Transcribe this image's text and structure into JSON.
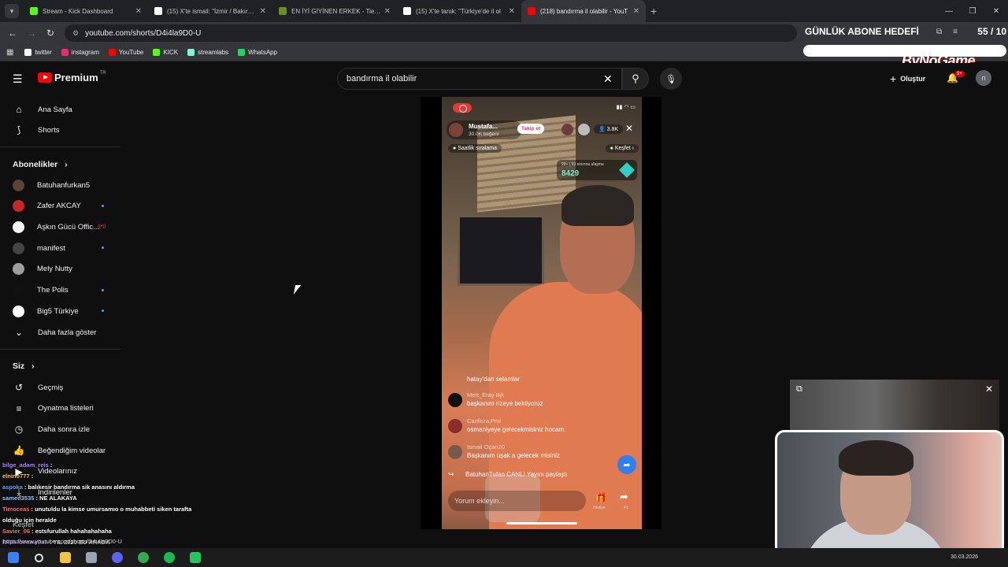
{
  "browser": {
    "tabs": [
      {
        "title": "Stream - Kick Dashboard",
        "favicon_color": "#53fc18",
        "active": false
      },
      {
        "title": "(15) X'te ismail: \"İzmir / Bakırçay",
        "favicon_color": "#ffffff",
        "active": false
      },
      {
        "title": "EN İYİ GİYİNEN ERKEK - Tier Li",
        "favicon_color": "#6b8e23",
        "active": false
      },
      {
        "title": "(15) X'te tanık: \"Türkiye'de il ol",
        "favicon_color": "#ffffff",
        "active": false
      },
      {
        "title": "(218) bandırma il olabilir - YouT",
        "favicon_color": "#ff0000",
        "active": true
      }
    ],
    "url": "youtube.com/shorts/D4i4la9D0-U",
    "bookmarks": [
      {
        "label": "twitter",
        "color": "#ffffff"
      },
      {
        "label": "instagram",
        "color": "#e1306c"
      },
      {
        "label": "YouTube",
        "color": "#ff0000"
      },
      {
        "label": "KICK",
        "color": "#53fc18"
      },
      {
        "label": "streamlabs",
        "color": "#80f5d2"
      },
      {
        "label": "WhatsApp",
        "color": "#25d366"
      }
    ]
  },
  "overlay": {
    "goal_title": "GÜNLÜK ABONE HEDEFİ",
    "goal_count": "55 / 10",
    "goal_fill_fraction": 1.0,
    "brand": "ByNoGame"
  },
  "youtube": {
    "logo_text": "Premium",
    "logo_region": "TR",
    "search_value": "bandırma il olabilir",
    "create_label": "Oluştur",
    "notif_badge": "9+",
    "avatar_letter": "n",
    "sidebar": {
      "main": [
        {
          "label": "Ana Sayfa",
          "icon": "home-icon"
        },
        {
          "label": "Shorts",
          "icon": "shorts-icon"
        }
      ],
      "subs_title": "Abonelikler",
      "subs": [
        {
          "label": "Batuhanfurkan5",
          "color": "#5a4636",
          "dot": false,
          "live": false
        },
        {
          "label": "Zafer AKCAY",
          "color": "#c62828",
          "dot": true,
          "live": false
        },
        {
          "label": "Aşkın Gücü Offic...",
          "color": "#f5f5f5",
          "dot": false,
          "live": true
        },
        {
          "label": "manifest",
          "color": "#444444",
          "dot": true,
          "live": false
        },
        {
          "label": "Mely Nutty",
          "color": "#9e9e9e",
          "dot": false,
          "live": false
        },
        {
          "label": "The Polis",
          "color": "#111111",
          "dot": true,
          "live": false
        },
        {
          "label": "Big5 Türkiye",
          "color": "#ffffff",
          "dot": true,
          "live": false
        }
      ],
      "show_more": "Daha fazla göster",
      "you_title": "Siz",
      "you": [
        {
          "label": "Geçmiş",
          "icon": "history-icon"
        },
        {
          "label": "Oynatma listeleri",
          "icon": "playlist-icon"
        },
        {
          "label": "Daha sonra izle",
          "icon": "clock-icon"
        },
        {
          "label": "Beğendiğim videolar",
          "icon": "thumbs-up-icon"
        },
        {
          "label": "Videolarınız",
          "icon": "video-icon"
        },
        {
          "label": "İndirilenler",
          "icon": "download-icon"
        }
      ],
      "explore_title": "Keşfet"
    }
  },
  "short": {
    "host_name": "Mustafa...",
    "host_likes": "30.0K beğeni",
    "follow_label": "Takip et",
    "viewers": "3.8K",
    "rank_label": "Saatlik sıralama",
    "explore_label": "Keşfet",
    "goal_small": "99+ | 99 sınırına ulaşma",
    "goal_number": "8429",
    "comments": [
      {
        "user": "",
        "text": "hatay'dan selamlar"
      },
      {
        "user": "Mert_Eray Bjk",
        "text": "başkanım rizeye bekliyoruz"
      },
      {
        "user": "Canfeza.Pml",
        "text": "osmaniyeye gelecekmisiniz hocam."
      },
      {
        "user": "Ismail Oçan20",
        "text": "Başkanım uşak a gelecek misiniz"
      }
    ],
    "share_line": "BatuhanTufan CANLI Yayını paylaştı",
    "input_placeholder": "Yorum ekleyin...",
    "gift_label": "Hediye",
    "share_count": "41"
  },
  "chat": [
    {
      "user": "bilge_adam_reis",
      "text": " :",
      "color": "#a78bfa"
    },
    {
      "user": "elnino777",
      "text": " :",
      "color": "#f2c94c"
    },
    {
      "user": "aspoka",
      "text": " : balıkesir bandırma sik anasını aldırma",
      "color": "#60a5fa"
    },
    {
      "user": "samed3535",
      "text": " : NE ALAKAYA",
      "color": "#93c5fd"
    },
    {
      "user": "Timoceas",
      "text": " : unutuldu la kimse umursamıo o muhabbeti siken tarafta",
      "color": "#f87171"
    },
    {
      "user": "",
      "text": "olduğu için heralde",
      "color": "#ffffff"
    },
    {
      "user": "Savier_06",
      "text": " : estsfurullah hahahahahaha",
      "color": "#f87171"
    },
    {
      "user": "lordofbesmellah",
      "text": " : YIL 2020 BU ARADA",
      "color": "#a78bfa"
    }
  ],
  "status_url": "https://www.youtube.com/shorts/D4i4la9D0-U",
  "taskbar": {
    "date": "30.03.2026",
    "apps": [
      {
        "name": "windows-start-icon",
        "color": "#3b82f6"
      },
      {
        "name": "search-icon",
        "color": "#dddddd"
      },
      {
        "name": "file-explorer-icon",
        "color": "#f4c542"
      },
      {
        "name": "app-icon",
        "color": "#9aa5b1"
      },
      {
        "name": "discord-icon",
        "color": "#5865f2"
      },
      {
        "name": "chrome-icon",
        "color": "#34a853"
      },
      {
        "name": "spotify-icon",
        "color": "#1db954"
      },
      {
        "name": "app2-icon",
        "color": "#22c55e"
      }
    ]
  }
}
